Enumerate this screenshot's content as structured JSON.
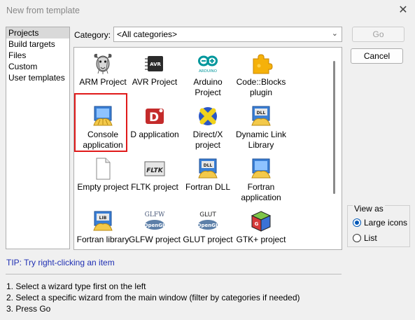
{
  "window": {
    "title": "New from template",
    "close_glyph": "✕"
  },
  "left_list": {
    "items": [
      {
        "label": "Projects",
        "selected": true
      },
      {
        "label": "Build targets"
      },
      {
        "label": "Files"
      },
      {
        "label": "Custom"
      },
      {
        "label": "User templates"
      }
    ]
  },
  "category": {
    "label": "Category:",
    "value": "<All categories>",
    "chevron": "⌄"
  },
  "templates": [
    {
      "label": "ARM Project",
      "icon": "gnu-icon"
    },
    {
      "label": "AVR Project",
      "icon": "avr-chip-icon"
    },
    {
      "label": "Arduino Project",
      "icon": "arduino-icon"
    },
    {
      "label": "Code::Blocks plugin",
      "icon": "puzzle-plugin-icon"
    },
    {
      "label": "Console application",
      "icon": "console-app-icon",
      "selected": true
    },
    {
      "label": "D application",
      "icon": "d-language-icon"
    },
    {
      "label": "Direct/X project",
      "icon": "directx-icon"
    },
    {
      "label": "Dynamic Link Library",
      "icon": "dll-icon"
    },
    {
      "label": "Empty project",
      "icon": "empty-page-icon"
    },
    {
      "label": "FLTK project",
      "icon": "fltk-icon"
    },
    {
      "label": "Fortran DLL",
      "icon": "fortran-dll-icon"
    },
    {
      "label": "Fortran application",
      "icon": "fortran-app-icon"
    },
    {
      "label": "Fortran library",
      "icon": "fortran-lib-icon"
    },
    {
      "label": "GLFW project",
      "icon": "glfw-icon",
      "brand": "GLFW",
      "sub": "OpenGL"
    },
    {
      "label": "GLUT project",
      "icon": "glut-icon",
      "brand": "GLUT",
      "sub": "OpenGL"
    },
    {
      "label": "GTK+ project",
      "icon": "gtk-cube-icon"
    }
  ],
  "icon_text": {
    "avr": "AVR",
    "arduino": "ARDUINO",
    "dll": "DLL",
    "fltk": "FLTK",
    "lib": "LIB",
    "d": "D",
    "gtk_g": "G"
  },
  "buttons": {
    "go": "Go",
    "cancel": "Cancel"
  },
  "view_as": {
    "label": "View as",
    "large_icons": "Large icons",
    "list": "List",
    "selected": "large_icons"
  },
  "tip": "TIP: Try right-clicking an item",
  "instructions": [
    "1. Select a wizard type first on the left",
    "2. Select a specific wizard from the main window (filter by categories if needed)",
    "3. Press Go"
  ],
  "colors": {
    "tip_text": "#1f2fb3",
    "selection_border": "#e01a1a",
    "radio_accent": "#0058b7"
  }
}
